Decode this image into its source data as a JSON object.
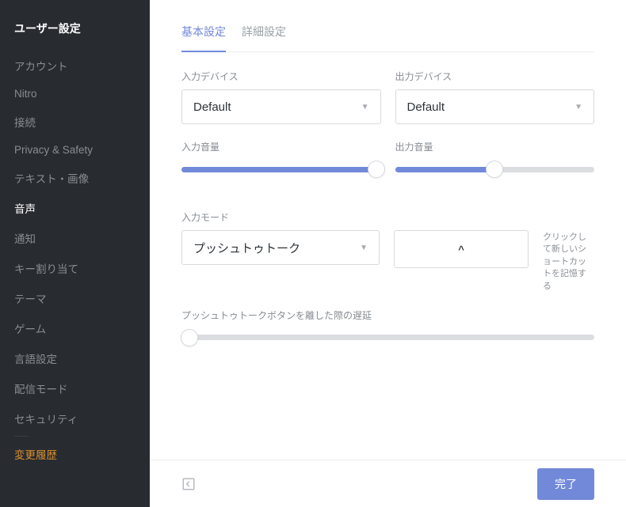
{
  "sidebar": {
    "title": "ユーザー設定",
    "items": [
      {
        "label": "アカウント"
      },
      {
        "label": "Nitro"
      },
      {
        "label": "接続"
      },
      {
        "label": "Privacy & Safety"
      },
      {
        "label": "テキスト・画像"
      },
      {
        "label": "音声",
        "active": true
      },
      {
        "label": "通知"
      },
      {
        "label": "キー割り当て"
      },
      {
        "label": "テーマ"
      },
      {
        "label": "ゲーム"
      },
      {
        "label": "言語設定"
      },
      {
        "label": "配信モード"
      },
      {
        "label": "セキュリティ"
      }
    ],
    "changelog": "変更履歴"
  },
  "tabs": {
    "basic": "基本設定",
    "advanced": "詳細設定"
  },
  "inputDevice": {
    "label": "入力デバイス",
    "value": "Default"
  },
  "outputDevice": {
    "label": "出力デバイス",
    "value": "Default"
  },
  "inputVolume": {
    "label": "入力音量",
    "percent": 98
  },
  "outputVolume": {
    "label": "出力音量",
    "percent": 50
  },
  "inputMode": {
    "label": "入力モード",
    "value": "プッシュトゥトーク"
  },
  "shortcut": {
    "glyph": "^",
    "hint": "クリックして新しいショートカットを記憶する"
  },
  "releaseDelay": {
    "label": "プッシュトゥトークボタンを離した際の遅延",
    "percent": 2
  },
  "footer": {
    "done": "完了"
  },
  "colors": {
    "accent": "#7289da",
    "sidebarBg": "#282b30",
    "highlight": "#d78f2e"
  }
}
